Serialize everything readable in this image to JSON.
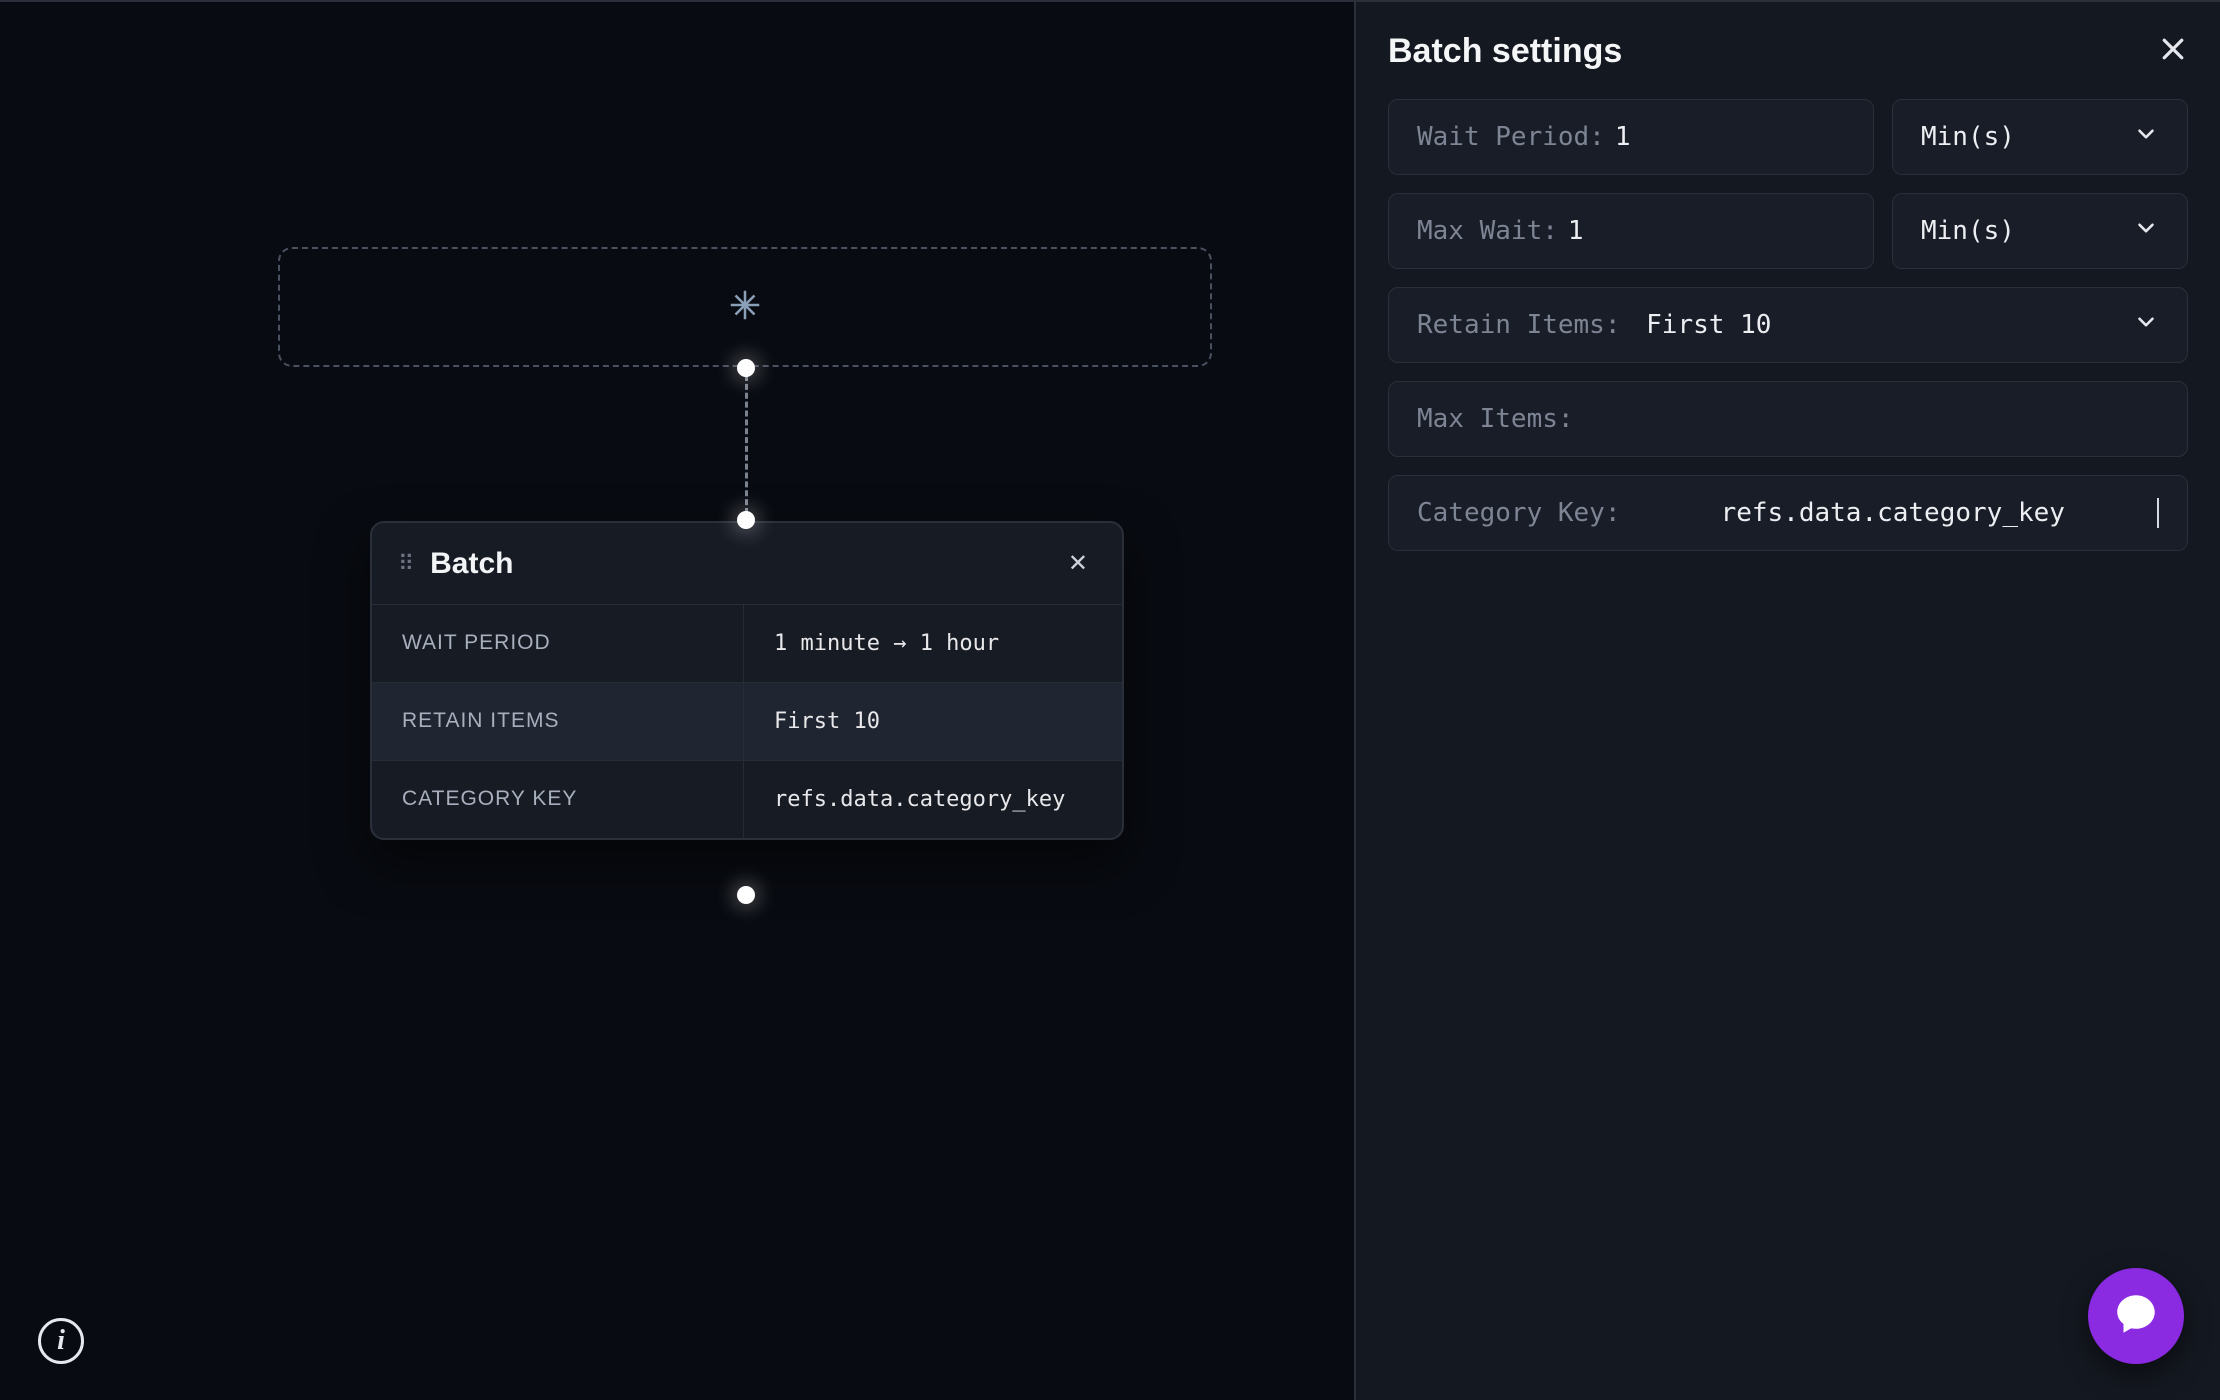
{
  "canvas": {
    "trigger_icon": "sparkle-icon"
  },
  "node": {
    "title": "Batch",
    "rows": [
      {
        "label": "WAIT PERIOD",
        "value": "1 minute → 1 hour"
      },
      {
        "label": "RETAIN ITEMS",
        "value": "First 10"
      },
      {
        "label": "CATEGORY KEY",
        "value": "refs.data.category_key"
      }
    ]
  },
  "panel": {
    "title": "Batch settings",
    "wait_period": {
      "label": "Wait Period:",
      "value": "1",
      "unit": "Min(s)"
    },
    "max_wait": {
      "label": "Max Wait:",
      "value": "1",
      "unit": "Min(s)"
    },
    "retain_items": {
      "label": "Retain Items:",
      "value": "First 10"
    },
    "max_items": {
      "label": "Max Items:",
      "value": ""
    },
    "category_key": {
      "label": "Category Key:",
      "value": "refs.data.category_key"
    }
  }
}
